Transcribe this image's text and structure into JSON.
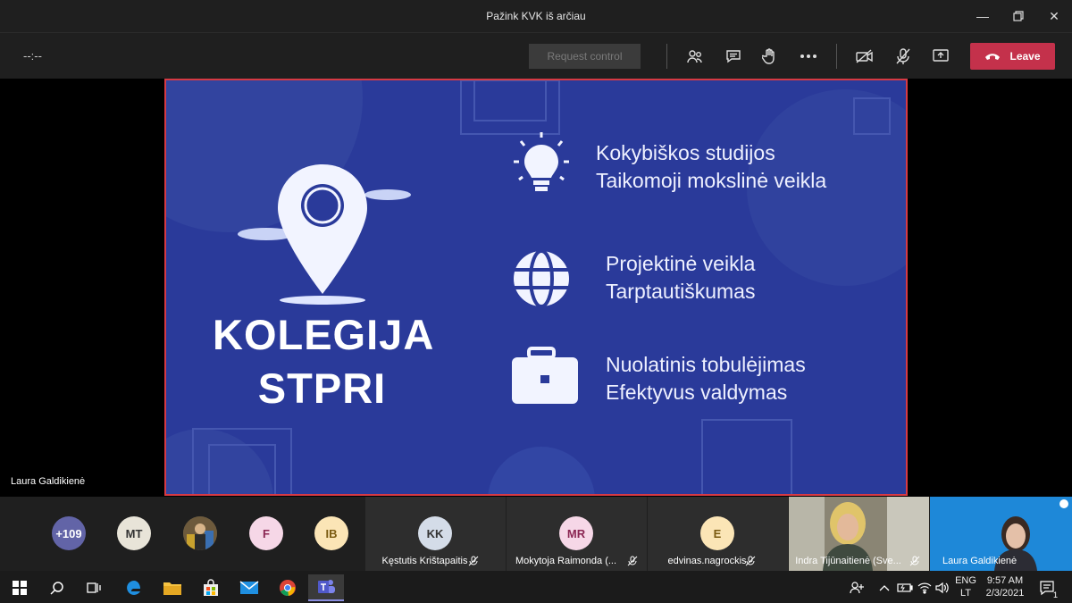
{
  "window": {
    "title": "Pažink KVK iš arčiau"
  },
  "toolbar": {
    "timer": "--:--",
    "request_control_label": "Request control",
    "leave_label": "Leave"
  },
  "slide": {
    "brand_line1": "KOLEGIJA",
    "brand_line2": "STPRI",
    "features": [
      {
        "icon": "lightbulb-icon",
        "line1": "Kokybiškos studijos",
        "line2": "Taikomoji mokslinė veikla"
      },
      {
        "icon": "globe-icon",
        "line1": "Projektinė veikla",
        "line2": "Tarptautiškumas"
      },
      {
        "icon": "briefcase-icon",
        "line1": "Nuolatinis tobulėjimas",
        "line2": "Efektyvus valdymas"
      }
    ],
    "colors": {
      "background": "#2a3a9a",
      "border": "#d63a44"
    }
  },
  "presenter_label": "Laura Galdikienė",
  "participants": {
    "overflow": {
      "initials": "+109",
      "color": "#6264a7"
    },
    "avatars": [
      {
        "initials": "MT",
        "color": "#e8e4d8"
      },
      {
        "initials": "",
        "color": "#5a5a5a"
      },
      {
        "initials": "F",
        "color": "#f6d7e7"
      },
      {
        "initials": "IB",
        "color": "#fbe5b6"
      }
    ],
    "tiles": [
      {
        "initials": "KK",
        "name": "Kęstutis Krištapaitis",
        "color": "#d4dce8"
      },
      {
        "initials": "MR",
        "name": "Mokytoja Raimonda (...",
        "color": "#f6d7e7"
      },
      {
        "initials": "E",
        "name": "edvinas.nagrockis",
        "color": "#fbe5b6"
      }
    ],
    "video_tiles": [
      {
        "name": "Indra Tijūnaitienė (Sve..."
      },
      {
        "name": "Laura Galdikienė"
      }
    ]
  },
  "taskbar": {
    "language_top": "ENG",
    "language_bottom": "LT",
    "time": "9:57 AM",
    "date": "2/3/2021",
    "notification_count": "1"
  }
}
